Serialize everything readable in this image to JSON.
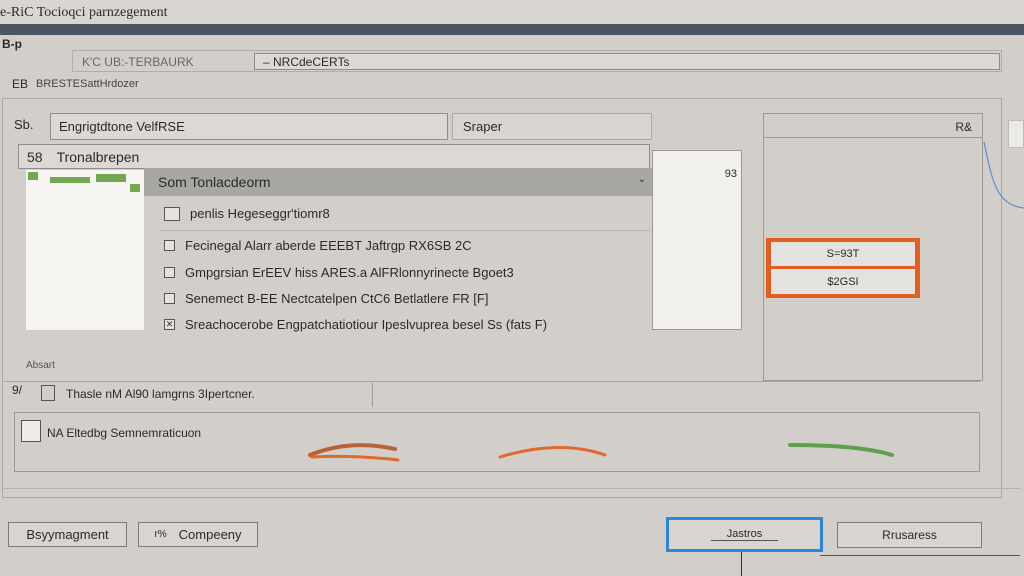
{
  "window": {
    "title": "e-RiC Tocioqci parnzegement"
  },
  "menu": {
    "item": "B-p"
  },
  "toolbar": {
    "left": "K'C UB:-TERBAURK",
    "right": "– NRCdeCERTs"
  },
  "section": {
    "icon": "EB",
    "label": "BRESTESattHrdozer"
  },
  "search": {
    "icon": "Sb.",
    "value": "Engrigtdtone VelfRSE",
    "button": "Sraper"
  },
  "tree": {
    "number": "58",
    "label": "Tronalbrepen"
  },
  "list": {
    "header": "Som  Tonlacdeorm",
    "scroll_value": "93",
    "items": [
      "penlis Hegeseggr'tiomr8",
      "Fecinegal Alarr aberde EEEBT Jaftrgp RX6SB 2C",
      "Gmpgrsian ErEEV hiss ARES.a AlFRlonnyrinecte Bgoet3",
      "Senemect B-EE Nectcatelpen CtC6 Betlatlere FR [F]",
      "Sreachocerobe Engpatchatiotiour Ipeslvuprea besel Ss (fats F)"
    ]
  },
  "right_panel": {
    "header": "R&",
    "options": [
      "S=93T",
      "$2GSI"
    ]
  },
  "status": {
    "label": "Absart",
    "icon": "9/",
    "line": "Thasle nM  Al90 lamgrns  3Ipertcner."
  },
  "group": {
    "label": "NA  Eltedbg Semnemraticuon",
    "colors": [
      "#b8623a",
      "#e06a2c",
      "#5fa04c"
    ]
  },
  "footer": {
    "buttons": [
      "Bsyymagment",
      "Compeeny"
    ],
    "btn2_icon": "r%",
    "primary": "Jastros",
    "secondary": "Rrusaress"
  },
  "colors": {
    "accent_orange": "#e2601f",
    "accent_blue": "#2e86d8",
    "titlebar_dark": "#4b5563"
  }
}
